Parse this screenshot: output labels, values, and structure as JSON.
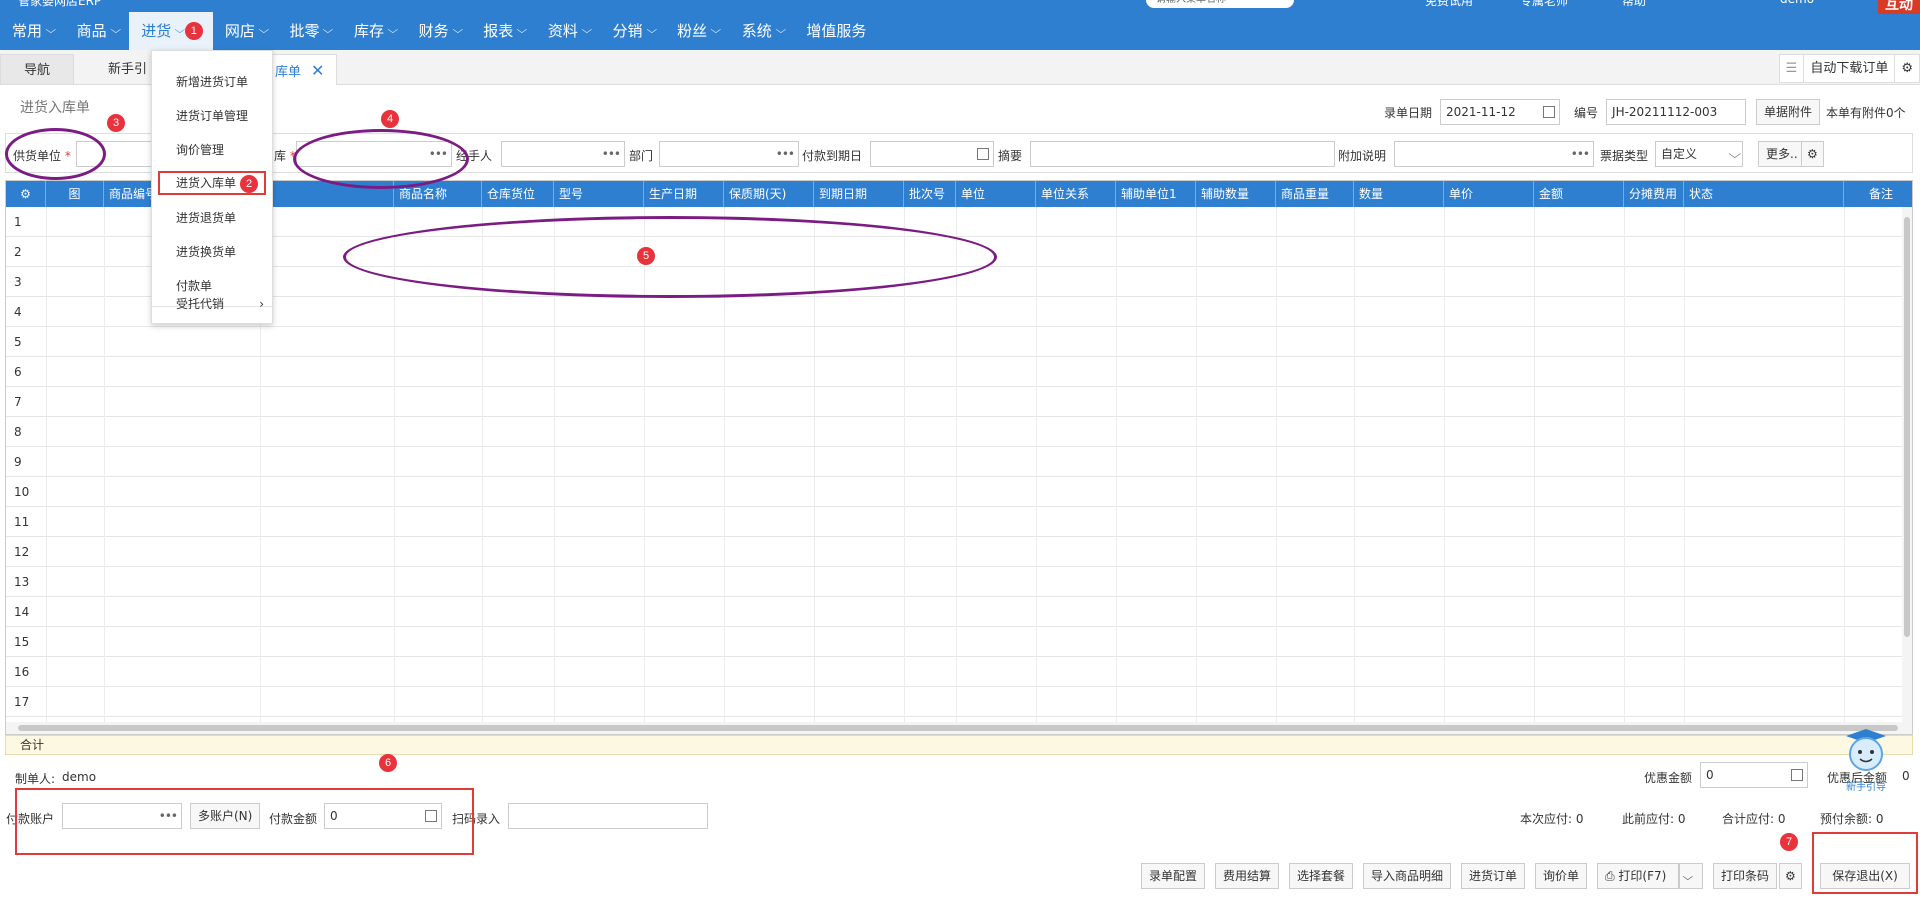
{
  "top_strip": {
    "logo_text": "管家婆网店ERP",
    "search_placeholder": "请输入菜单名称",
    "links": [
      "免费试用",
      "专属老师",
      "帮助",
      "demo"
    ],
    "hudong": "互动"
  },
  "nav": {
    "items": [
      "常用",
      "商品",
      "进货",
      "网店",
      "批零",
      "库存",
      "财务",
      "报表",
      "资料",
      "分销",
      "粉丝",
      "系统",
      "增值服务"
    ],
    "active_index": 2
  },
  "dropdown": {
    "items": [
      "新增进货订单",
      "进货订单管理",
      "询价管理",
      "进货入库单",
      "进货退货单",
      "进货换货单",
      "付款单",
      "受托代销"
    ],
    "selected_index": 3,
    "submenu_arrow_index": 7
  },
  "tabs": {
    "nav_label": "导航",
    "newbie_label": "新手引",
    "current_label": "库单",
    "right_label": "自动下载订单"
  },
  "header": {
    "title": "进货入库单",
    "date_label": "录单日期",
    "date_value": "2021-11-12",
    "number_label": "编号",
    "number_value": "JH-20211112-003",
    "attach_button": "单据附件",
    "attach_count": "本单有附件0个"
  },
  "filter": {
    "supplier_label": "供货单位",
    "warehouse_label": "库",
    "handler_label": "经手人",
    "dept_label": "部门",
    "pay_due_label": "付款到期日",
    "summary_label": "摘要",
    "extra_label": "附加说明",
    "bill_type_label": "票据类型",
    "bill_type_value": "自定义",
    "more_button": "更多.."
  },
  "grid": {
    "columns": [
      "图",
      "商品编号",
      "",
      "商品名称",
      "仓库货位",
      "型号",
      "生产日期",
      "保质期(天)",
      "到期日期",
      "批次号",
      "单位",
      "单位关系",
      "辅助单位1",
      "辅助数量",
      "商品重量",
      "数量",
      "单价",
      "金额",
      "分摊费用",
      "状态",
      "备注"
    ],
    "row_numbers": [
      "1",
      "2",
      "3",
      "4",
      "5",
      "6",
      "7",
      "8",
      "9",
      "10",
      "11",
      "12",
      "13",
      "14",
      "15",
      "16",
      "17"
    ],
    "total_label": "合计"
  },
  "footer": {
    "maker_label": "制单人:",
    "maker_value": "demo",
    "discount_label": "优惠金额",
    "discount_value": "0",
    "after_discount_label": "优惠后金额",
    "after_discount_value": "0",
    "account_label": "付款账户",
    "multi_account_button": "多账户(N)",
    "pay_amount_label": "付款金额",
    "pay_amount_value": "0",
    "scan_label": "扫码录入",
    "due_now_label": "本次应付:",
    "due_now_value": "0",
    "due_before_label": "此前应付:",
    "due_before_value": "0",
    "due_total_label": "合计应付:",
    "due_total_value": "0",
    "prepaid_label": "预付余额:",
    "prepaid_value": "0",
    "mascot_label": "新手引导"
  },
  "actions": [
    "录单配置",
    "费用结算",
    "选择套餐",
    "导入商品明细",
    "进货订单",
    "询价单",
    "打印(F7)",
    "打印条码",
    "保存退出(X)"
  ],
  "annotations": [
    "1",
    "2",
    "3",
    "4",
    "5",
    "6",
    "7"
  ],
  "colors": {
    "nav_blue": "#2f7fd1",
    "annotation_purple": "#7b1b83",
    "annotation_red": "#e03b3b",
    "total_row_bg": "#fdf8e1"
  }
}
